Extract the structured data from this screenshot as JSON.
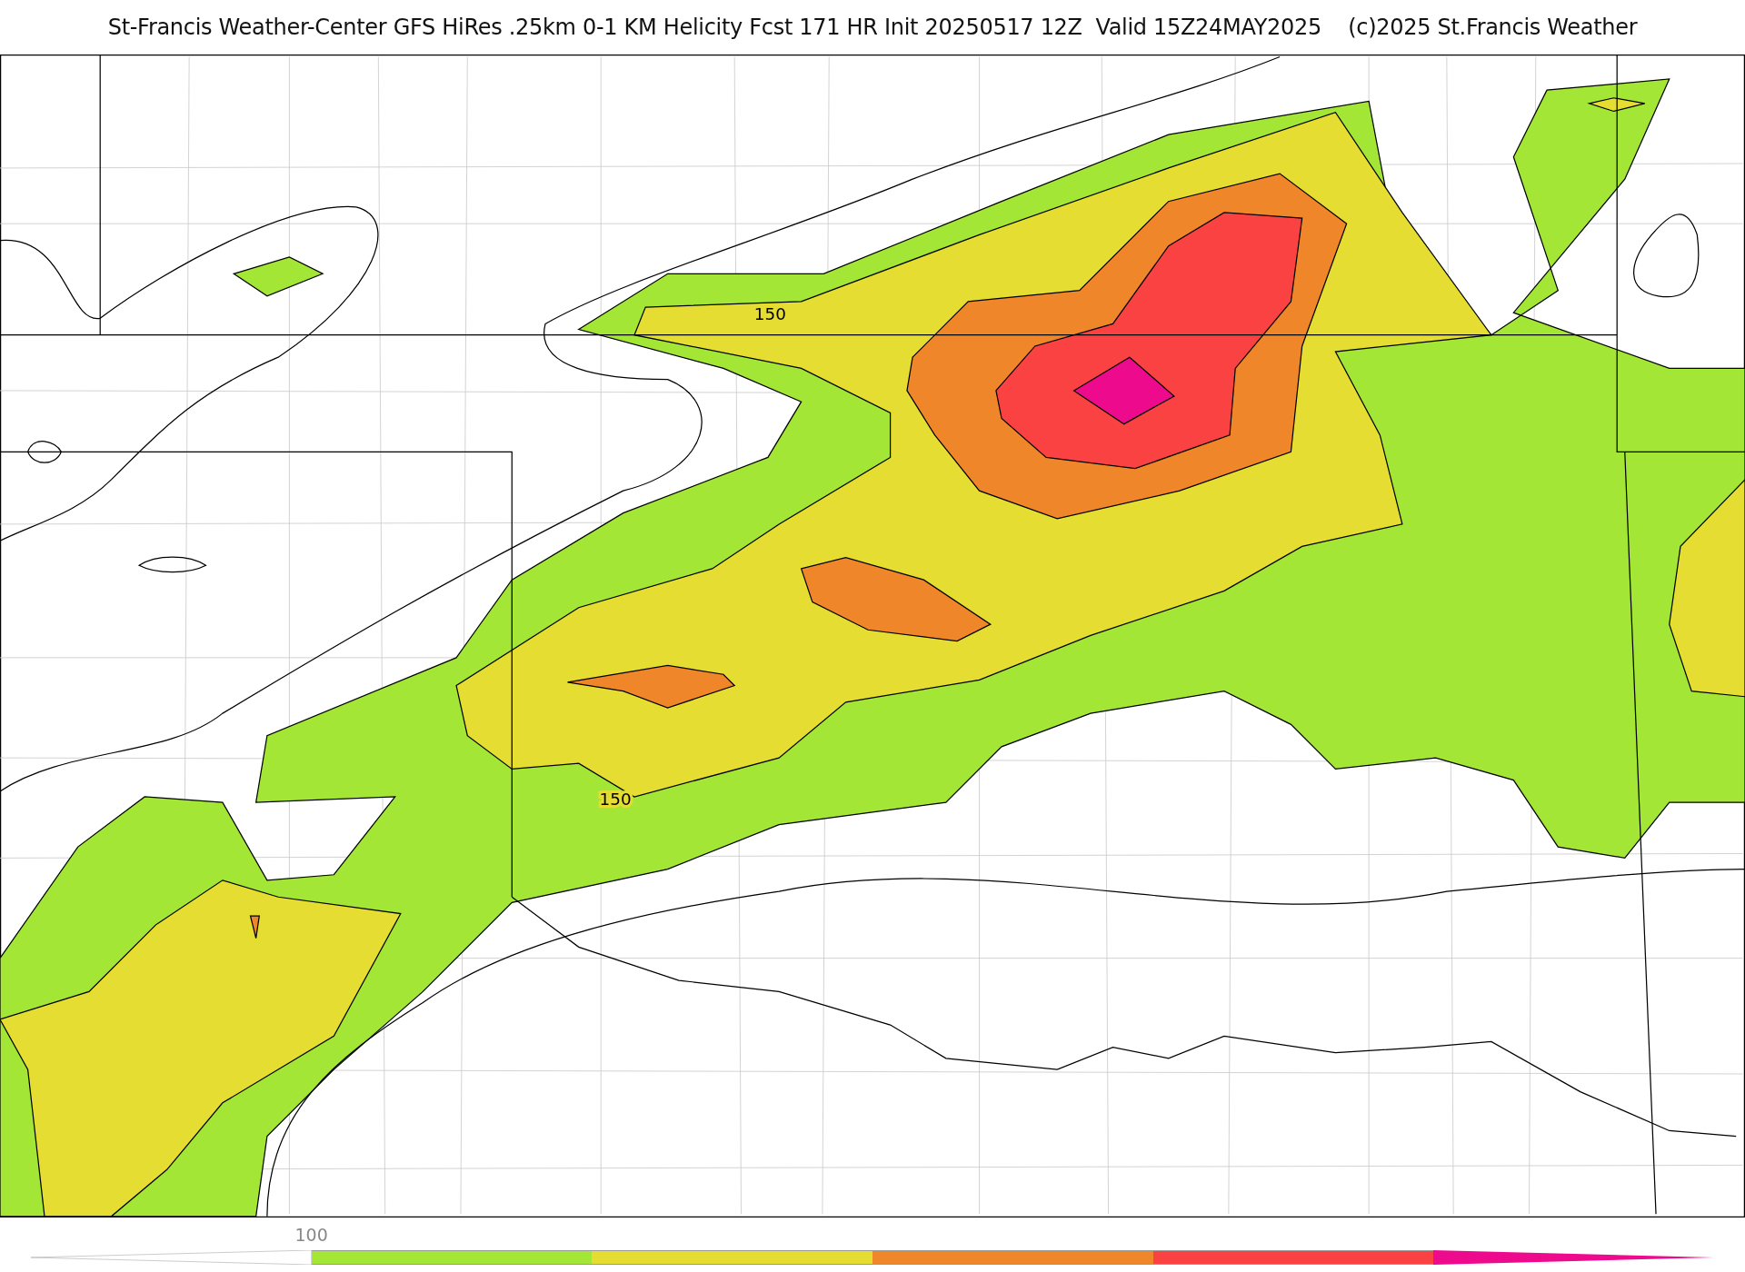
{
  "title": "St-Francis Weather-Center GFS HiRes .25km 0-1 KM Helicity Fcst 171 HR Init 20250517 12Z  Valid 15Z24MAY2025    (c)2025 St.Francis Weather",
  "map": {
    "contour_labels": [
      {
        "text": "150"
      },
      {
        "text": "150"
      }
    ]
  },
  "colorbar": {
    "ticks": [
      {
        "label": "100"
      }
    ],
    "segments": [
      {
        "kind": "triangle-left",
        "color": "#ffffff"
      },
      {
        "kind": "bar",
        "color": "#a3e635"
      },
      {
        "kind": "bar",
        "color": "#e6dd33"
      },
      {
        "kind": "bar",
        "color": "#f0862a"
      },
      {
        "kind": "bar",
        "color": "#fa4242"
      },
      {
        "kind": "triangle-right",
        "color": "#ee0a8c"
      }
    ]
  }
}
